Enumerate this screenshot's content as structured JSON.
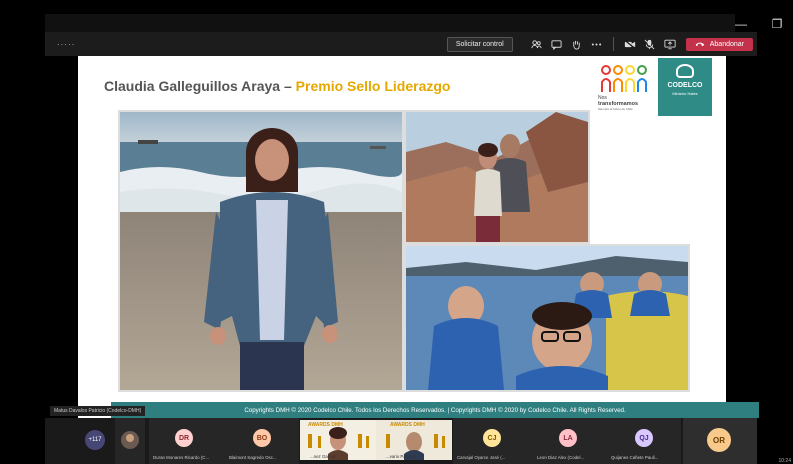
{
  "window": {
    "minimize": "—",
    "restore": "❐"
  },
  "callbar": {
    "timer": "·····",
    "request_control": "Solicitar control",
    "leave": "Abandonar"
  },
  "slide": {
    "title_name": "Claudia Galleguillos Araya",
    "title_dash": " – ",
    "title_award": "Premio Sello Liderazgo",
    "logo_nos_line1": "Nos",
    "logo_nos_line2": "transformamos",
    "logo_nos_line3": "Siempre al futuro de Chile",
    "logo_codelco": "CODELCO",
    "logo_codelco_sub": "Ministro Hales",
    "footer": "Copyrights DMH © 2020 Codelco Chile.  Todos los Derechos Reservados.  |  Copyrights DMH © 2020 by Codelco Chile. All Rights Reserved."
  },
  "speaker_label": "Matus Davalos Patricio (Codelco-DMH)",
  "participants": {
    "more_count": "+117",
    "tiles": [
      {
        "initials": "DR",
        "name": "Duran Monares Ricardo (C...",
        "color": "#ffd0d0"
      },
      {
        "initials": "BO",
        "name": "Blaimont Sagredo Osc...",
        "color": "#ffc8a8"
      },
      {
        "initials": "CJ",
        "name": "Carvajal Oyarce José (...",
        "color": "#ffe49a"
      },
      {
        "initials": "LA",
        "name": "Leon Diaz Alex (Codel...",
        "color": "#ffc0c8"
      },
      {
        "initials": "QJ",
        "name": "Quijanes Cañete Pauli...",
        "color": "#d8c8ff"
      },
      {
        "initials": "OR",
        "name": "",
        "color": "#f7c98a"
      }
    ],
    "awards_label_left": "AWARDS DMH",
    "awards_label_right": "AWARDS DMH",
    "awards_name_left": "...nez Garrido",
    "awards_name_right": "...vario Patricio"
  },
  "clock": "10:24"
}
